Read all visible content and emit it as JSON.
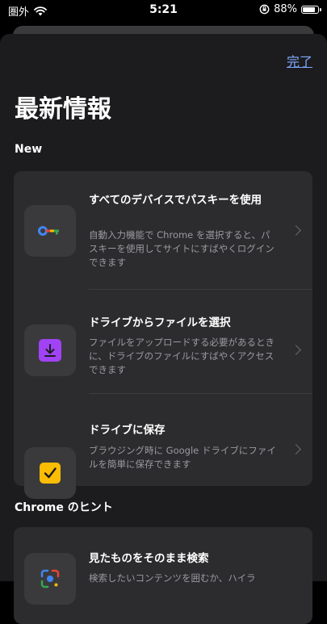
{
  "status_bar": {
    "carrier": "圏外",
    "time": "5:21",
    "battery_percent": "88%",
    "battery_level": 0.88
  },
  "header": {
    "done_label": "完了",
    "title": "最新情報"
  },
  "sections": {
    "new_label": "New",
    "hints_label": "Chrome のヒント"
  },
  "new_items": [
    {
      "title": "すべてのデバイスでパスキーを使用",
      "description": "自動入力機能で Chrome を選択すると、パスキーを使用してサイトにすばやくログインできます",
      "icon": "passkey-icon"
    },
    {
      "title": "ドライブからファイルを選択",
      "description": "ファイルをアップロードする必要があるときに、ドライブのファイルにすばやくアクセスできます",
      "icon": "drive-download-icon"
    },
    {
      "title": "ドライブに保存",
      "description": "ブラウジング時に Google ドライブにファイルを簡単に保存できます",
      "icon": "checkbox-icon"
    }
  ],
  "hint_items": [
    {
      "title": "見たものをそのまま検索",
      "description": "検索したいコンテンツを囲むか、ハイラ",
      "icon": "lens-icon"
    }
  ],
  "colors": {
    "accent": "#7fa9ff",
    "sheet_bg": "#1c1c1e",
    "card_bg": "#2c2c2e",
    "purple_tile": "#a142f4",
    "yellow_tile": "#fbbc04"
  }
}
